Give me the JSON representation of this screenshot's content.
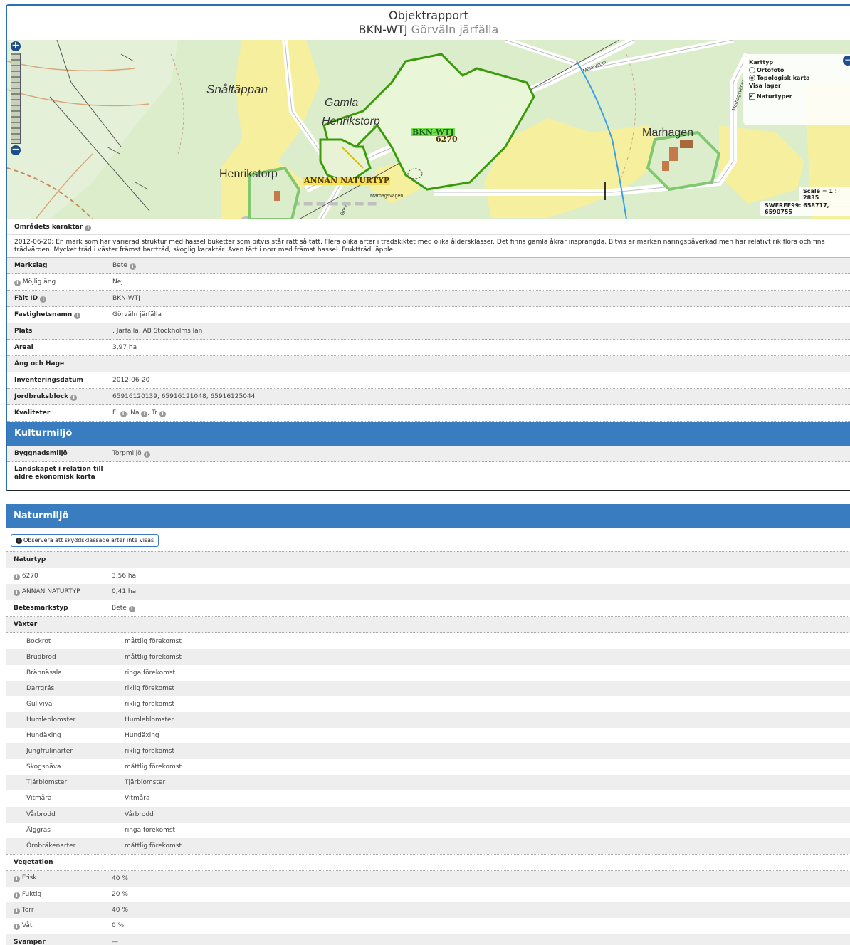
{
  "header": {
    "title": "Objektrapport",
    "object_id": "BKN-WTJ",
    "object_name": "Görväln järfälla"
  },
  "map": {
    "labels": {
      "place1": "Snåltäppan",
      "place2a": "Gamla",
      "place2b": "Henrikstorp",
      "place3": "Henrikstorp",
      "place4": "Marhagen",
      "road1": "Mälarvägen",
      "road2": "Marhagsvägen",
      "road3": "Marhagsvägen",
      "road4": "Görv"
    },
    "polygon_labels": {
      "main_id": "BKN-WTJ",
      "main_code": "6270",
      "other": "ANNAN NATURTYP"
    },
    "layer_switcher": {
      "heading_type": "Karttyp",
      "opt_ortho": "Ortofoto",
      "opt_topo": "Topologisk karta",
      "heading_layers": "Visa lager",
      "layer_nature": "Naturtyper",
      "selected": "Topologisk karta"
    },
    "scale": "Scale = 1 : 2835",
    "coords": "SWEREF99: 658717, 6590755",
    "zoom_in": "+",
    "zoom_out": "−",
    "toggle": "−",
    "colors": {
      "forest": "#ddeed0",
      "field": "#f6ef9e",
      "polygon": "#3a9a0c",
      "water": "#3aa0e6"
    }
  },
  "character": {
    "heading": "Områdets karaktär",
    "text": "2012-06-20: En mark som har varierad struktur med hassel buketter som bitvis står rätt så tätt. Flera olika arter i trädskiktet med olika åldersklasser. Det finns gamla åkrar insprängda. Bitvis är marken näringspåverkad men har relativt rik flora och fina trädvärden. Mycket träd i väster främst barrträd, skoglig karaktär. Även tätt i norr med främst hassel. Fruktträd, äpple."
  },
  "details": {
    "markslag_k": "Markslag",
    "markslag_v": "Bete",
    "mojlig_k": "Möjlig äng",
    "mojlig_v": "Nej",
    "faltid_k": "Fält ID",
    "faltid_v": "BKN-WTJ",
    "fastighet_k": "Fastighetsnamn",
    "fastighet_v": "Görväln järfälla",
    "plats_k": "Plats",
    "plats_v": ", Järfälla, AB Stockholms län",
    "areal_k": "Areal",
    "areal_v": "3,97 ha",
    "ang_k": "Äng och Hage",
    "inv_k": "Inventeringsdatum",
    "inv_v": "2012-06-20",
    "jord_k": "Jordbruksblock",
    "jord_v": "65916120139, 65916121048, 65916125044",
    "kval_k": "Kvaliteter",
    "kval_1": "Fl",
    "kval_2": "Na",
    "kval_3": "Tr"
  },
  "kultur": {
    "heading": "Kulturmiljö",
    "bygg_k": "Byggnadsmiljö",
    "bygg_v": "Torpmiljö",
    "land_k1": "Landskapet i relation till",
    "land_k2": "äldre ekonomisk karta"
  },
  "natur": {
    "heading": "Naturmiljö",
    "notice": "Observera att skyddsklassade arter inte visas",
    "naturtyp_k": "Naturtyp",
    "nt1_k": "6270",
    "nt1_v": "3,56 ha",
    "nt2_k": "ANNAN NATURTYP",
    "nt2_v": "0,41 ha",
    "betes_k": "Betesmarkstyp",
    "betes_v": "Bete",
    "vaxter_k": "Växter",
    "vaxter": [
      {
        "k": "Bockrot",
        "v": "måttlig förekomst"
      },
      {
        "k": "Brudbröd",
        "v": "måttlig förekomst"
      },
      {
        "k": "Brännässla",
        "v": "ringa förekomst"
      },
      {
        "k": "Darrgräs",
        "v": "riklig förekomst"
      },
      {
        "k": "Gullviva",
        "v": "riklig förekomst"
      },
      {
        "k": "Humleblomster",
        "v": "Humleblomster"
      },
      {
        "k": "Hundäxing",
        "v": "Hundäxing"
      },
      {
        "k": "Jungfrulinarter",
        "v": "riklig förekomst"
      },
      {
        "k": "Skogsnäva",
        "v": "måttlig förekomst"
      },
      {
        "k": "Tjärblomster",
        "v": "Tjärblomster"
      },
      {
        "k": "Vitmåra",
        "v": "Vitmåra"
      },
      {
        "k": "Vårbrodd",
        "v": "Vårbrodd"
      },
      {
        "k": "Älggräs",
        "v": "ringa förekomst"
      },
      {
        "k": "Örnbräkenarter",
        "v": "måttlig förekomst"
      }
    ],
    "veg_k": "Vegetation",
    "veg": [
      {
        "k": "Frisk",
        "v": "40 %"
      },
      {
        "k": "Fuktig",
        "v": "20 %"
      },
      {
        "k": "Torr",
        "v": "40 %"
      },
      {
        "k": "Våt",
        "v": "0 %"
      }
    ],
    "svamp_k": "Svampar",
    "svamp_v": "—"
  },
  "info_icon": "i"
}
